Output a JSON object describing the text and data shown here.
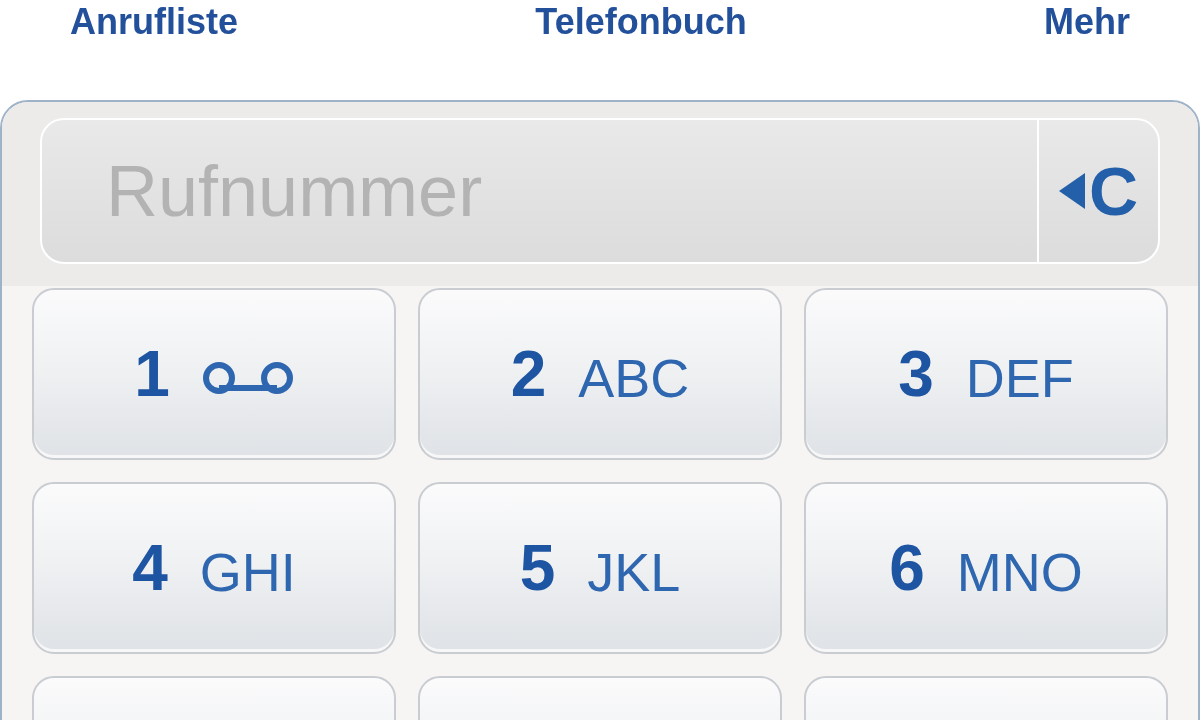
{
  "tabs": [
    {
      "label": "Anrufliste"
    },
    {
      "label": "Telefonbuch"
    },
    {
      "label": "Mehr"
    }
  ],
  "number_field": {
    "placeholder": "Rufnummer"
  },
  "clear_button": {
    "label": "C"
  },
  "keys": [
    {
      "kind": "voicemail",
      "digit": "1"
    },
    {
      "kind": "letters",
      "digit": "2",
      "letters": "ABC"
    },
    {
      "kind": "letters",
      "digit": "3",
      "letters": "DEF"
    },
    {
      "kind": "letters",
      "digit": "4",
      "letters": "GHI"
    },
    {
      "kind": "letters",
      "digit": "5",
      "letters": "JKL"
    },
    {
      "kind": "letters",
      "digit": "6",
      "letters": "MNO"
    },
    {
      "kind": "cut"
    },
    {
      "kind": "cut"
    },
    {
      "kind": "cut"
    }
  ]
}
